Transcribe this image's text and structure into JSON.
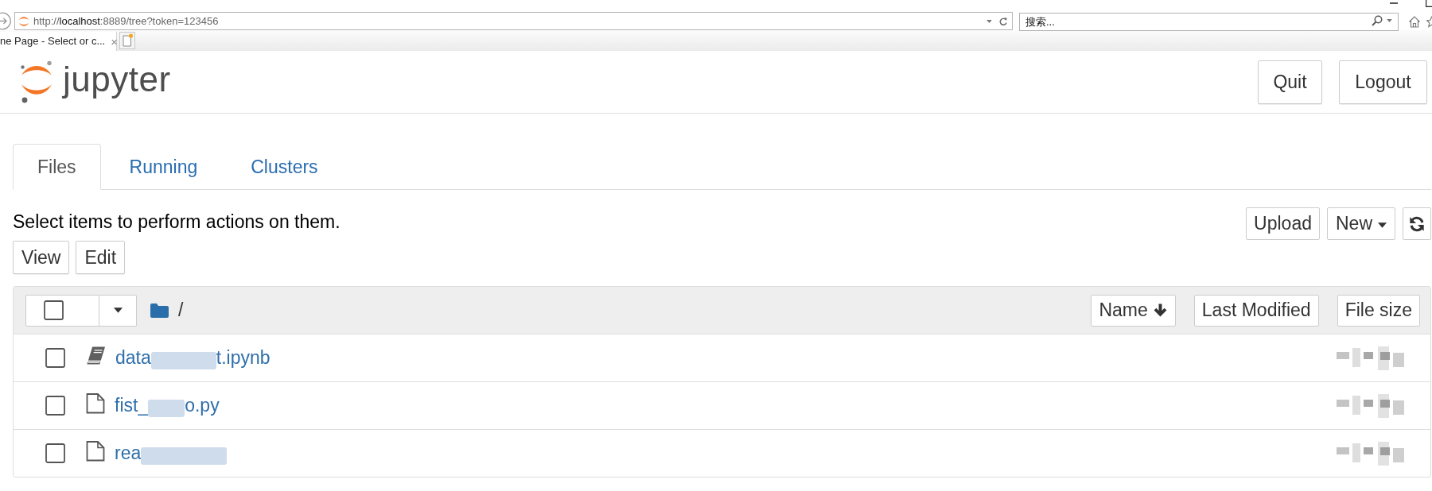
{
  "browser": {
    "address": {
      "scheme": "http://",
      "host": "localhost",
      "rest": ":8889/tree?token=123456"
    },
    "search": {
      "placeholder": "搜索..."
    },
    "tab": {
      "title": "ne Page - Select or c...",
      "close": "×"
    }
  },
  "header": {
    "logo_text": "jupyter",
    "buttons": [
      "Quit",
      "Logout"
    ]
  },
  "tabs": [
    {
      "label": "Files",
      "selected": true
    },
    {
      "label": "Running",
      "selected": false
    },
    {
      "label": "Clusters",
      "selected": false
    }
  ],
  "instructions": "Select items to perform actions on them.",
  "left_buttons": [
    "View",
    "Edit"
  ],
  "right_buttons": [
    {
      "kind": "plain",
      "label": "Upload"
    },
    {
      "kind": "dropdown",
      "label": "New"
    },
    {
      "kind": "refresh"
    }
  ],
  "file_list": {
    "select_all": {
      "checked": false
    },
    "path": "/",
    "sort_buttons": [
      {
        "label": "Name",
        "sorted": true
      },
      {
        "label": "Last Modified",
        "sorted": false
      },
      {
        "label": "File size",
        "sorted": false
      }
    ],
    "rows": [
      {
        "kind": "notebook",
        "name_parts": [
          "data",
          "t.ipynb"
        ],
        "checked": false
      },
      {
        "kind": "file",
        "name_parts": [
          "fist_",
          "o.py"
        ],
        "checked": false
      },
      {
        "kind": "file",
        "name_parts": [
          "rea"
        ],
        "checked": false
      }
    ]
  }
}
